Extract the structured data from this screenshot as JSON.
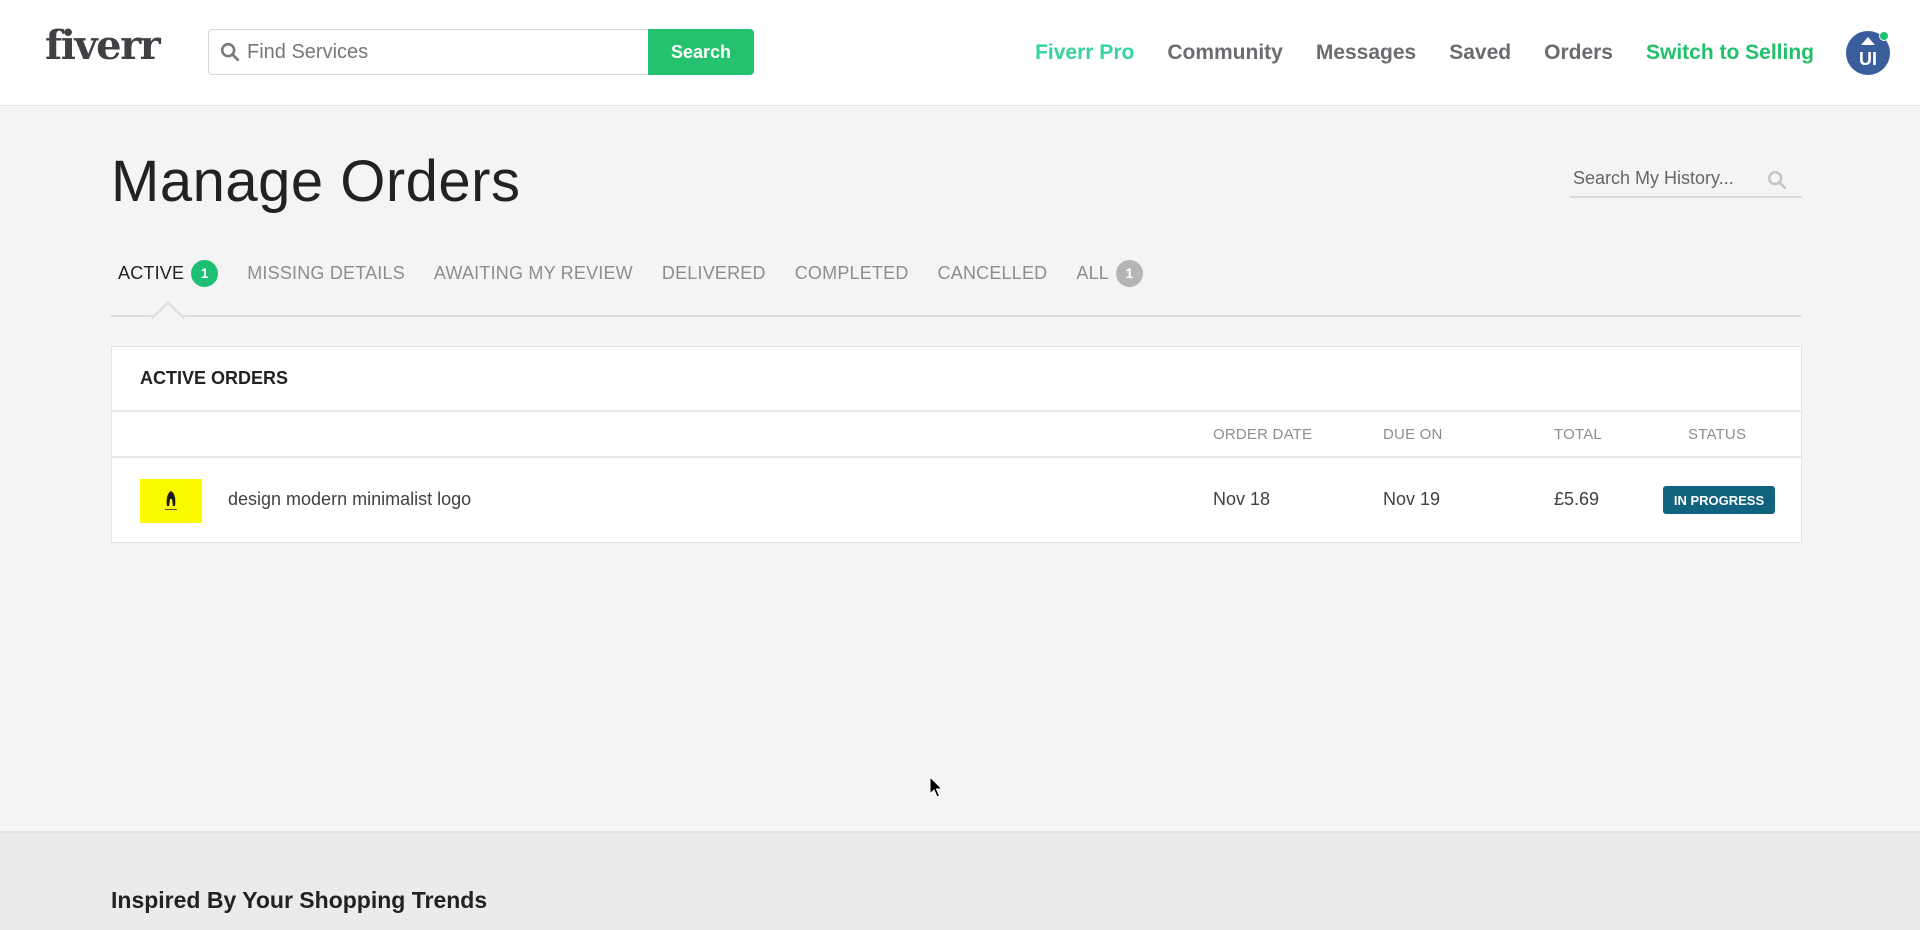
{
  "header": {
    "logo": "fiverr",
    "search": {
      "placeholder": "Find Services",
      "value": "",
      "button_label": "Search",
      "icon": "search-icon"
    },
    "nav": [
      {
        "label": "Fiverr Pro",
        "color": "#36d39a"
      },
      {
        "label": "Community"
      },
      {
        "label": "Messages"
      },
      {
        "label": "Saved"
      },
      {
        "label": "Orders"
      },
      {
        "label": "Switch to Selling",
        "color": "#22c06b"
      }
    ],
    "avatar": {
      "initials": "UI",
      "online": true,
      "color": "#3a5e9c"
    }
  },
  "main": {
    "title": "Manage Orders",
    "history_search": {
      "placeholder": "Search My History...",
      "value": "",
      "icon": "search-icon"
    },
    "tabs": [
      {
        "label": "ACTIVE",
        "badge": "1",
        "active": true
      },
      {
        "label": "MISSING DETAILS"
      },
      {
        "label": "AWAITING MY REVIEW"
      },
      {
        "label": "DELIVERED"
      },
      {
        "label": "COMPLETED"
      },
      {
        "label": "CANCELLED"
      },
      {
        "label": "ALL",
        "badge": "1"
      }
    ],
    "orders": {
      "title": "ACTIVE ORDERS",
      "columns": [
        "ORDER DATE",
        "DUE ON",
        "TOTAL",
        "STATUS"
      ],
      "rows": [
        {
          "gig": "design modern minimalist logo",
          "order_date": "Nov 18",
          "due_on": "Nov 19",
          "total": "£5.69",
          "status": "IN PROGRESS",
          "status_color": "#11627f",
          "thumbnail_color": "#fbfa00"
        }
      ]
    }
  },
  "trends": {
    "title": "Inspired By Your Shopping Trends"
  },
  "colors": {
    "accent": "#1dbf73",
    "status": "#11627f",
    "avatar": "#3a5e9c"
  }
}
